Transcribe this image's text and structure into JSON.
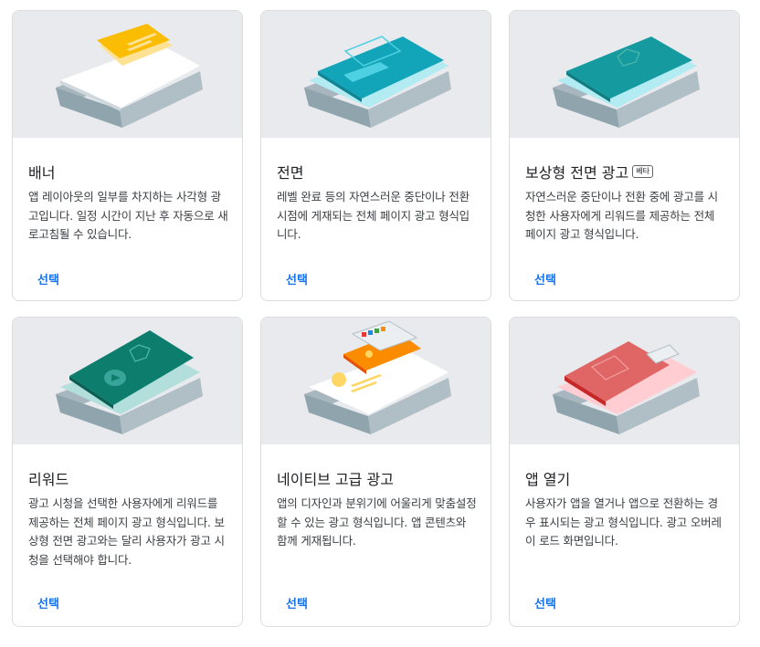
{
  "cards": [
    {
      "title": "배너",
      "badge": "",
      "description": "앱 레이아웃의 일부를 차지하는 사각형 광고입니다. 일정 시간이 지난 후 자동으로 새로고침될 수 있습니다.",
      "action": "선택"
    },
    {
      "title": "전면",
      "badge": "",
      "description": "레벨 완료 등의 자연스러운 중단이나 전환 시점에 게재되는 전체 페이지 광고 형식입니다.",
      "action": "선택"
    },
    {
      "title": "보상형 전면 광고",
      "badge": "베타",
      "description": "자연스러운 중단이나 전환 중에 광고를 시청한 사용자에게 리워드를 제공하는 전체 페이지 광고 형식입니다.",
      "action": "선택"
    },
    {
      "title": "리워드",
      "badge": "",
      "description": "광고 시청을 선택한 사용자에게 리워드를 제공하는 전체 페이지 광고 형식입니다. 보상형 전면 광고와는 달리 사용자가 광고 시청을 선택해야 합니다.",
      "action": "선택"
    },
    {
      "title": "네이티브 고급 광고",
      "badge": "",
      "description": "앱의 디자인과 분위기에 어울리게 맞춤설정할 수 있는 광고 형식입니다. 앱 콘텐츠와 함께 게재됩니다.",
      "action": "선택"
    },
    {
      "title": "앱 열기",
      "badge": "",
      "description": "사용자가 앱을 열거나 앱으로 전환하는 경우 표시되는 광고 형식입니다. 광고 오버레이 로드 화면입니다.",
      "action": "선택"
    }
  ],
  "colors": {
    "banner": "#fbbc04",
    "interstitial": "#12a4b8",
    "rewarded_interstitial": "#159aa0",
    "rewarded": "#0d7d6e",
    "native": "#fb8c00",
    "app_open": "#e06666",
    "link": "#1a73e8"
  }
}
